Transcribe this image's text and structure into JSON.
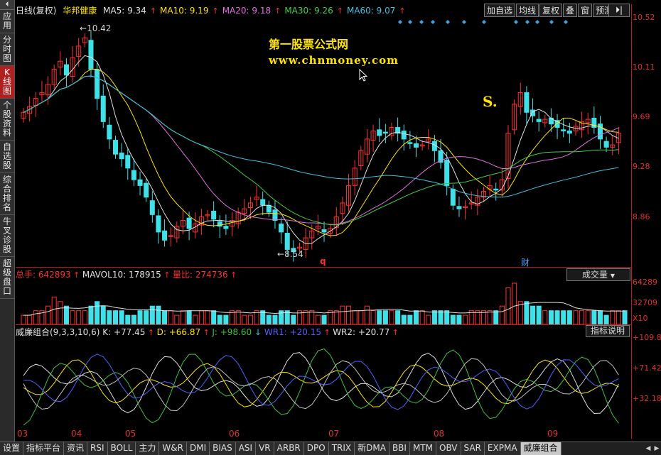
{
  "left_nav": {
    "top_arrow": "⏴",
    "items": [
      {
        "label": "应用",
        "active": false
      },
      {
        "label": "分时图",
        "active": false
      },
      {
        "label": "K线图",
        "active": true
      },
      {
        "label": "个股资料",
        "active": false
      },
      {
        "label": "自选股",
        "active": false
      },
      {
        "label": "综合排名",
        "active": false
      },
      {
        "label": "牛叉诊股",
        "active": false
      },
      {
        "label": "超级盘口",
        "active": false
      }
    ]
  },
  "price_panel": {
    "period": "日线(复权)",
    "stock_name": "华邦健康",
    "ma": [
      {
        "label": "MA5: 9.34",
        "color": "#e0e0e0"
      },
      {
        "label": "MA10: 9.19",
        "color": "#ffe400"
      },
      {
        "label": "MA20: 9.18",
        "color": "#e070e0"
      },
      {
        "label": "MA30: 9.26",
        "color": "#40d040"
      },
      {
        "label": "MA60: 9.07",
        "color": "#40c0e0"
      }
    ],
    "y_ticks": [
      "10.52",
      "10.11",
      "9.69",
      "9.28",
      "8.86"
    ],
    "high_label": "10.42",
    "low_label": "8.54",
    "mark_q": "q",
    "mark_cai": "财",
    "mark_s": "S.",
    "watermark_title": "第一股票公式网",
    "watermark_url": "www.chnmoney.com"
  },
  "toolbar": {
    "buttons": [
      "加自选",
      "均线",
      "复权",
      "叠",
      "窗",
      "预测"
    ],
    "window_btn": "⏵|"
  },
  "volume_panel": {
    "total_hands": "总手: 642893",
    "mavol": "MAVOL10: 178915",
    "volume_ratio": "量比: 274736",
    "selector": "成交量",
    "y_ticks": [
      "64289",
      "32709",
      "X10"
    ]
  },
  "indicator_panel": {
    "title": "威廉组合(9,3,3,10,6)",
    "k": "K: +77.45",
    "d": "D: +66.87",
    "j": "J: +98.60",
    "wr1": "WR1: +20.15",
    "wr2": "WR2: +20.77",
    "help_button": "指标说明",
    "y_ticks": [
      "+109.8",
      "+71.42",
      "+32.18"
    ]
  },
  "time_axis": [
    "03",
    "04",
    "05",
    "06",
    "07",
    "08",
    "09"
  ],
  "bottom_tabs": [
    {
      "label": "设置",
      "active": false
    },
    {
      "label": "指标平台",
      "active": false
    },
    {
      "label": "资讯",
      "active": false
    },
    {
      "label": "RSI",
      "active": false
    },
    {
      "label": "BOLL",
      "active": false
    },
    {
      "label": "主力",
      "active": false
    },
    {
      "label": "W&R",
      "active": false
    },
    {
      "label": "DMI",
      "active": false
    },
    {
      "label": "BIAS",
      "active": false
    },
    {
      "label": "ASI",
      "active": false
    },
    {
      "label": "VR",
      "active": false
    },
    {
      "label": "ARBR",
      "active": false
    },
    {
      "label": "DPO",
      "active": false
    },
    {
      "label": "TRIX",
      "active": false
    },
    {
      "label": "新DMA",
      "active": false
    },
    {
      "label": "BBI",
      "active": false
    },
    {
      "label": "MTM",
      "active": false
    },
    {
      "label": "OBV",
      "active": false
    },
    {
      "label": "SAR",
      "active": false
    },
    {
      "label": "EXPMA",
      "active": false
    },
    {
      "label": "威廉组合",
      "active": true
    }
  ],
  "colors": {
    "up": "#ff3030",
    "down": "#40e0e8",
    "frame": "#b02020"
  },
  "chart_data": {
    "type": "candlestick",
    "title": "",
    "ylim": [
      8.45,
      10.6
    ],
    "x_months": [
      "03",
      "04",
      "05",
      "06",
      "07",
      "08",
      "09"
    ],
    "close": [
      9.78,
      9.83,
      9.9,
      9.95,
      10.02,
      10.15,
      10.22,
      10.1,
      10.25,
      10.35,
      10.42,
      10.15,
      9.9,
      9.7,
      9.55,
      9.42,
      9.38,
      9.3,
      9.2,
      9.15,
      9.05,
      8.9,
      8.75,
      8.68,
      8.72,
      8.8,
      8.85,
      8.78,
      8.82,
      8.88,
      8.9,
      8.86,
      8.8,
      8.78,
      8.85,
      8.92,
      8.95,
      9.0,
      9.05,
      8.98,
      8.92,
      8.85,
      8.75,
      8.6,
      8.58,
      8.62,
      8.7,
      8.76,
      8.8,
      8.75,
      8.78,
      8.88,
      9.0,
      9.15,
      9.3,
      9.45,
      9.55,
      9.62,
      9.58,
      9.6,
      9.65,
      9.6,
      9.55,
      9.52,
      9.48,
      9.5,
      9.55,
      9.45,
      9.35,
      9.15,
      8.98,
      8.95,
      8.97,
      9.0,
      9.05,
      9.1,
      9.15,
      9.12,
      9.2,
      9.6,
      9.85,
      9.95,
      9.78,
      9.75,
      9.7,
      9.72,
      9.68,
      9.65,
      9.62,
      9.6,
      9.66,
      9.7,
      9.72,
      9.65,
      9.55,
      9.48,
      9.5,
      9.6
    ],
    "volume_index": [
      2,
      2,
      3,
      3,
      4,
      6,
      5,
      4,
      3,
      3,
      3,
      4,
      5,
      4,
      3,
      3,
      3,
      2,
      2,
      3,
      3,
      4,
      4,
      3,
      3,
      2,
      3,
      3,
      2,
      3,
      3,
      3,
      2,
      2,
      3,
      3,
      2,
      2,
      3,
      3,
      2,
      2,
      3,
      3,
      2,
      3,
      3,
      3,
      2,
      2,
      3,
      3,
      4,
      4,
      3,
      3,
      4,
      3,
      3,
      3,
      3,
      3,
      2,
      2,
      3,
      3,
      2,
      3,
      3,
      3,
      2,
      2,
      2,
      3,
      3,
      3,
      3,
      3,
      4,
      8,
      9,
      5,
      5,
      4,
      4,
      3,
      3,
      3,
      3,
      3,
      3,
      3,
      3,
      3,
      3,
      2,
      3,
      3,
      3
    ]
  }
}
